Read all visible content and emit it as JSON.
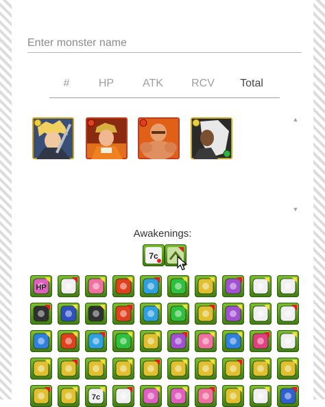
{
  "search": {
    "placeholder": "Enter monster name",
    "value": ""
  },
  "sort_tabs": [
    {
      "label": "#",
      "active": false
    },
    {
      "label": "HP",
      "active": false
    },
    {
      "label": "ATK",
      "active": false
    },
    {
      "label": "RCV",
      "active": false
    },
    {
      "label": "Total",
      "active": true
    }
  ],
  "monsters": [
    {
      "name": "blonde-swordsman-portrait",
      "frame_color": "#c8a020",
      "attribute": "light"
    },
    {
      "name": "orange-jacket-hero-portrait",
      "frame_color": "#d04020",
      "attribute": "fire"
    },
    {
      "name": "muscular-fighter-portrait",
      "frame_color": "#d04020",
      "attribute": "fire"
    },
    {
      "name": "white-haired-warrior-portrait",
      "frame_color": "#c8a020",
      "attribute": "light"
    }
  ],
  "awakenings": {
    "label": "Awakenings:",
    "selected": [
      {
        "icon": "seven-combo-awakening-icon",
        "text": "7c"
      },
      {
        "icon": "binding-resist-plus-awakening-icon",
        "text": ""
      }
    ],
    "grid": [
      {
        "icon": "hp-plus-awakening-icon",
        "color": "#e060c0",
        "text": "HP"
      },
      {
        "icon": "attack-plus-awakening-icon",
        "color": "#f0f0f0",
        "text": ""
      },
      {
        "icon": "heart-plus-awakening-icon",
        "color": "#f070a0",
        "text": ""
      },
      {
        "icon": "fire-enhanced-orb-icon",
        "color": "#e04020",
        "text": ""
      },
      {
        "icon": "water-enhanced-orb-icon",
        "color": "#30a0e0",
        "text": ""
      },
      {
        "icon": "wood-enhanced-orb-icon",
        "color": "#30c040",
        "text": ""
      },
      {
        "icon": "light-enhanced-orb-icon",
        "color": "#e0c030",
        "text": ""
      },
      {
        "icon": "dark-enhanced-orb-icon",
        "color": "#a050d0",
        "text": ""
      },
      {
        "icon": "two-prong-attack-icon",
        "color": "#f0f0f0",
        "text": ""
      },
      {
        "icon": "skill-boost-resist-icon",
        "color": "#f0f0f0",
        "text": ""
      },
      {
        "icon": "blind-resist-icon",
        "color": "#303030",
        "text": ""
      },
      {
        "icon": "jammer-resist-icon",
        "color": "#3050c0",
        "text": ""
      },
      {
        "icon": "poison-resist-icon",
        "color": "#303030",
        "text": ""
      },
      {
        "icon": "fire-row-awakening-icon",
        "color": "#e04020",
        "text": ""
      },
      {
        "icon": "water-row-awakening-icon",
        "color": "#30a0e0",
        "text": ""
      },
      {
        "icon": "wood-row-awakening-icon",
        "color": "#30c040",
        "text": ""
      },
      {
        "icon": "light-row-awakening-icon",
        "color": "#e0c030",
        "text": ""
      },
      {
        "icon": "dark-row-awakening-icon",
        "color": "#a050d0",
        "text": ""
      },
      {
        "icon": "auto-recover-awakening-icon",
        "color": "#f0f0f0",
        "text": ""
      },
      {
        "icon": "bind-recovery-awakening-icon",
        "color": "#f0f0f0",
        "text": ""
      },
      {
        "icon": "extend-time-awakening-icon",
        "color": "#3080e0",
        "text": ""
      },
      {
        "icon": "fire-attack-plus-icon",
        "color": "#e04020",
        "text": ""
      },
      {
        "icon": "water-attack-plus-icon",
        "color": "#30a0e0",
        "text": ""
      },
      {
        "icon": "wood-attack-plus-icon",
        "color": "#30c040",
        "text": ""
      },
      {
        "icon": "light-attack-plus-icon",
        "color": "#e0c030",
        "text": ""
      },
      {
        "icon": "dark-attack-plus-icon",
        "color": "#a050d0",
        "text": ""
      },
      {
        "icon": "recover-plus-icon",
        "color": "#f070a0",
        "text": ""
      },
      {
        "icon": "tpa-awakening-icon",
        "color": "#3080e0",
        "text": ""
      },
      {
        "icon": "reduce-damage-awakening-icon",
        "color": "#e04080",
        "text": ""
      },
      {
        "icon": "skill-boost-plus-icon",
        "color": "#f0f0f0",
        "text": ""
      },
      {
        "icon": "dragon-killer-icon",
        "color": "#e0c030",
        "text": ""
      },
      {
        "icon": "god-killer-icon",
        "color": "#e0c030",
        "text": ""
      },
      {
        "icon": "devil-killer-icon",
        "color": "#e0c030",
        "text": ""
      },
      {
        "icon": "machine-killer-icon",
        "color": "#e0c030",
        "text": ""
      },
      {
        "icon": "balanced-killer-icon",
        "color": "#e0c030",
        "text": ""
      },
      {
        "icon": "attacker-killer-icon",
        "color": "#e0c030",
        "text": ""
      },
      {
        "icon": "physical-killer-icon",
        "color": "#e0c030",
        "text": ""
      },
      {
        "icon": "healer-killer-icon",
        "color": "#e0c030",
        "text": ""
      },
      {
        "icon": "sensor-awakening-icon",
        "color": "#e0c030",
        "text": ""
      },
      {
        "icon": "evo-material-killer-icon",
        "color": "#e0c030",
        "text": ""
      },
      {
        "icon": "awaken-material-killer-icon",
        "color": "#e0c030",
        "text": ""
      },
      {
        "icon": "enhance-material-killer-icon",
        "color": "#e0c030",
        "text": ""
      },
      {
        "icon": "seven-combo-awakening-icon",
        "color": "#f0f0f0",
        "text": "7c"
      },
      {
        "icon": "guard-break-awakening-icon",
        "color": "#f0f0f0",
        "text": ""
      },
      {
        "icon": "follow-up-attack-icon",
        "color": "#e060c0",
        "text": ""
      },
      {
        "icon": "team-hp-plus-icon",
        "color": "#e060c0",
        "text": ""
      },
      {
        "icon": "team-rcv-plus-icon",
        "color": "#f070a0",
        "text": ""
      },
      {
        "icon": "damage-void-piercer-icon",
        "color": "#e0c030",
        "text": ""
      },
      {
        "icon": "awoken-assist-icon",
        "color": "#f0f0f0",
        "text": ""
      },
      {
        "icon": "super-follow-up-icon",
        "color": "#3060d0",
        "text": ""
      }
    ]
  }
}
